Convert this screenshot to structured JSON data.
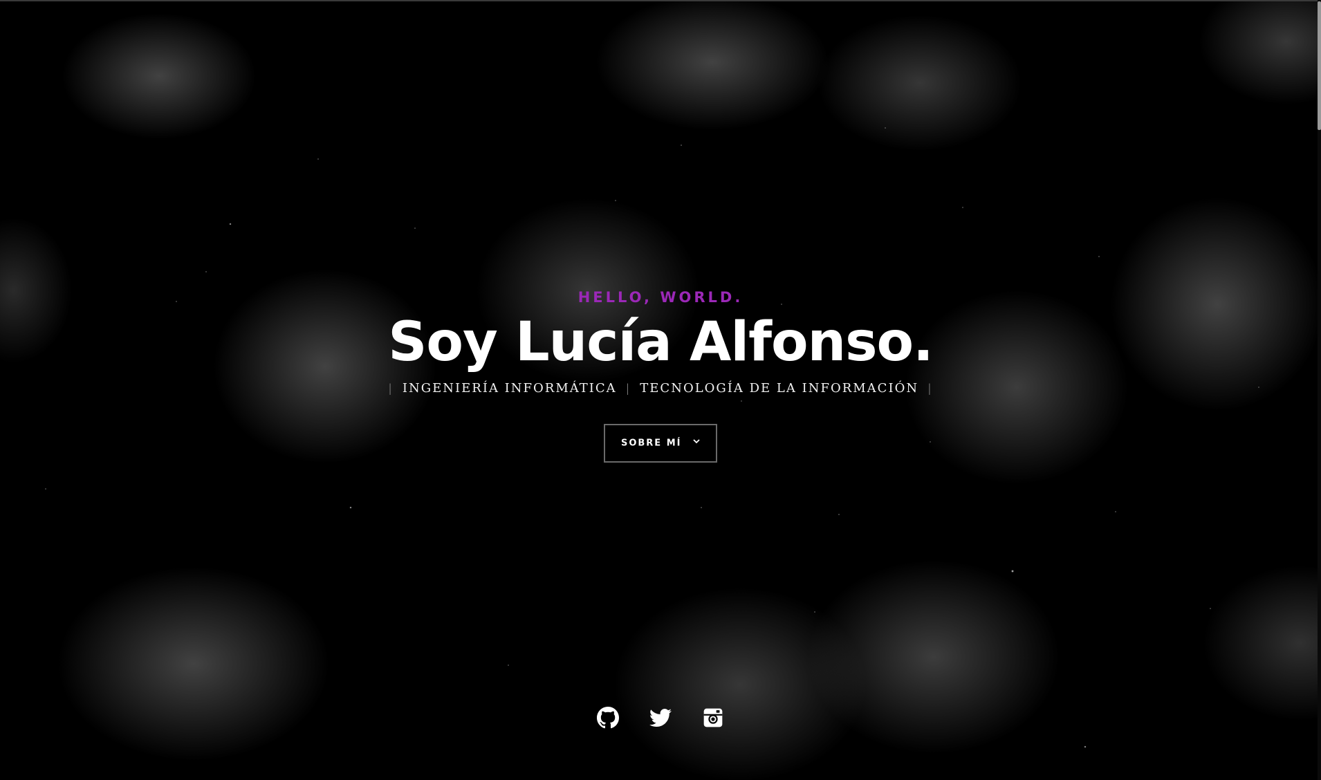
{
  "hero": {
    "intro": "HELLO, WORLD.",
    "name": "Soy Lucía Alfonso.",
    "tags": [
      "INGENIERÍA INFORMÁTICA",
      "TECNOLOGÍA DE LA INFORMACIÓN"
    ],
    "separator": "|",
    "cta_label": "SOBRE MÍ",
    "cta_icon": "chevron-down-icon"
  },
  "social": {
    "items": [
      {
        "icon": "github-icon"
      },
      {
        "icon": "twitter-icon"
      },
      {
        "icon": "instagram-icon"
      }
    ]
  },
  "colors": {
    "accent": "#9b28b7",
    "background": "#000000",
    "text": "#ffffff"
  }
}
